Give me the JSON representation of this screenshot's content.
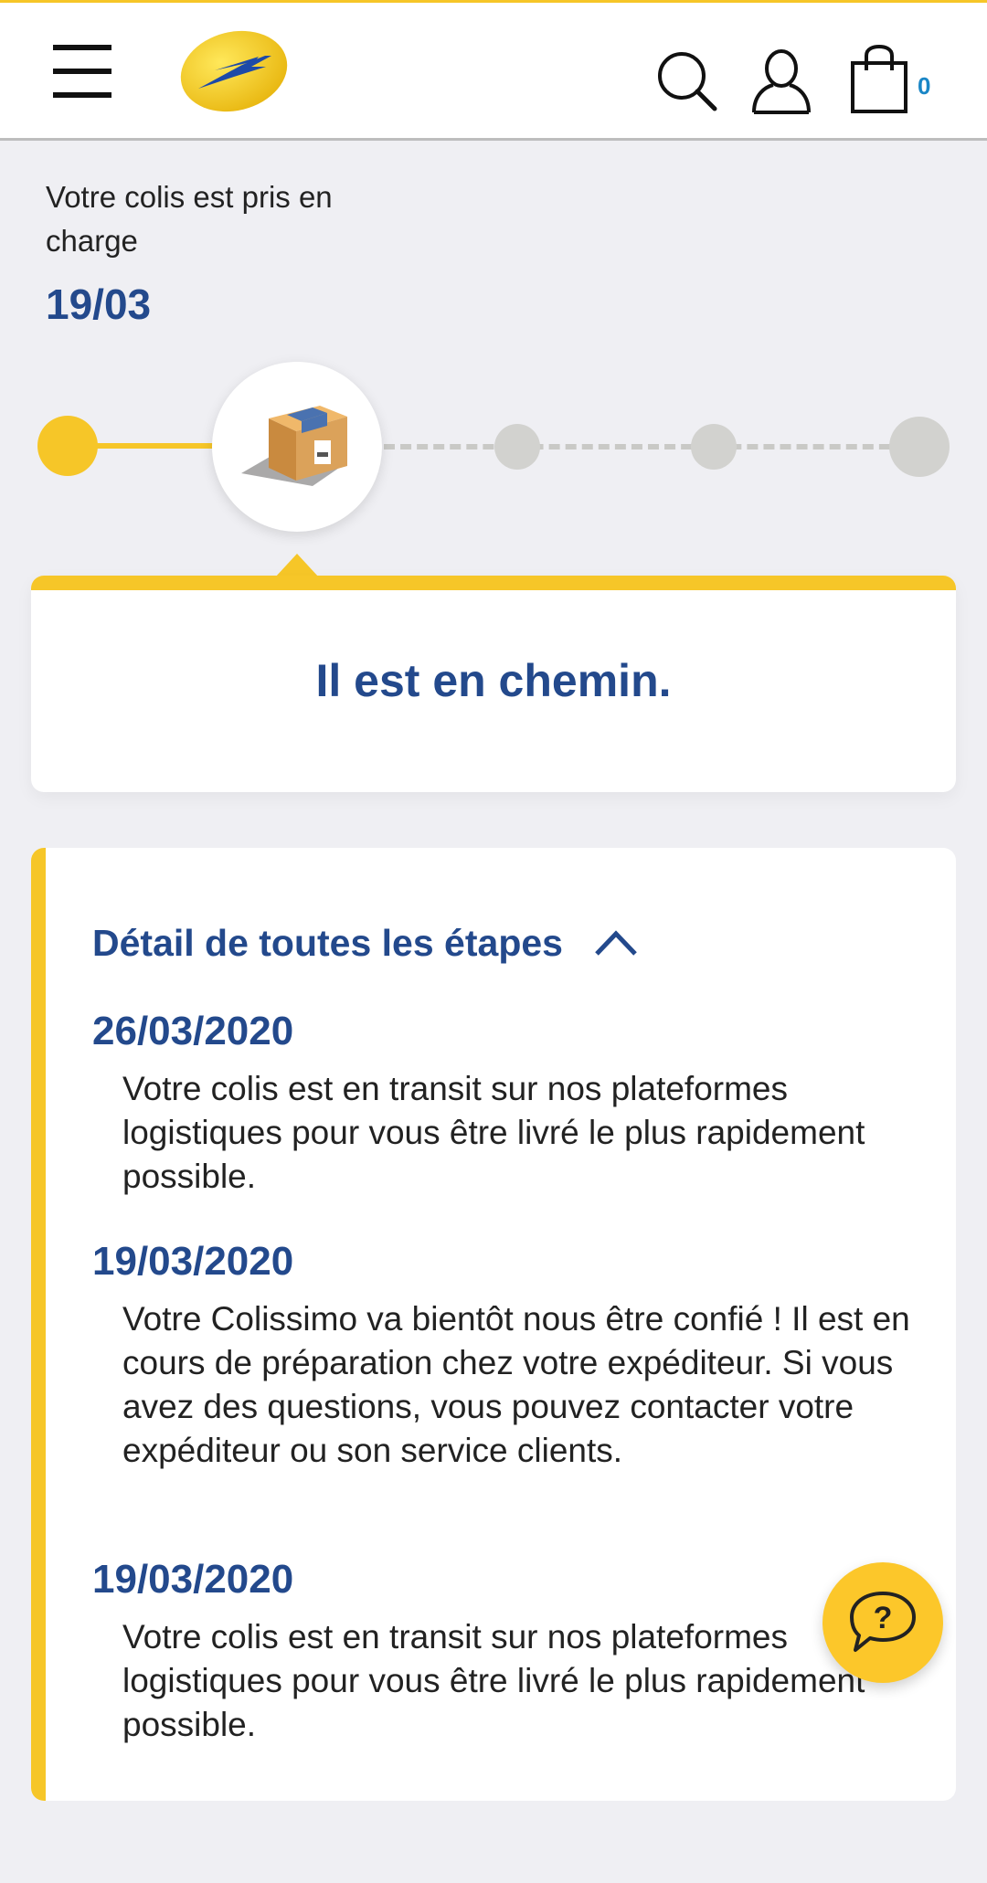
{
  "header": {
    "menu_icon": "hamburger-menu-icon",
    "logo": "la-poste-logo",
    "icons": [
      "search-icon",
      "user-icon",
      "shopping-bag-icon"
    ],
    "cart_count": "0"
  },
  "status": {
    "label": "Votre colis est pris en charge",
    "date": "19/03"
  },
  "tracker": {
    "steps_total": 5,
    "current_step": 2,
    "current_icon": "package-icon"
  },
  "message": {
    "text": "Il est en chemin."
  },
  "details": {
    "title": "Détail de toutes les étapes",
    "toggle_icon": "chevron-up-icon",
    "events": [
      {
        "date": "26/03/2020",
        "text": "Votre colis est en transit sur nos plateformes logistiques pour vous être livré le plus rapidement possible."
      },
      {
        "date": "19/03/2020",
        "text": "Votre Colissimo va bientôt nous être confié ! Il est en cours de préparation chez votre expéditeur. Si vous avez des questions, vous pouvez contacter votre expéditeur ou son service clients."
      },
      {
        "date": "19/03/2020",
        "text": "Votre colis est en transit sur nos plateformes logistiques pour vous être livré le plus rapidement possible."
      }
    ]
  },
  "help": {
    "icon": "help-chat-icon",
    "symbol": "?"
  },
  "colors": {
    "brand_yellow": "#f6c628",
    "brand_blue": "#23498c",
    "background": "#efeff3",
    "pending_grey": "#d2d2cf"
  }
}
